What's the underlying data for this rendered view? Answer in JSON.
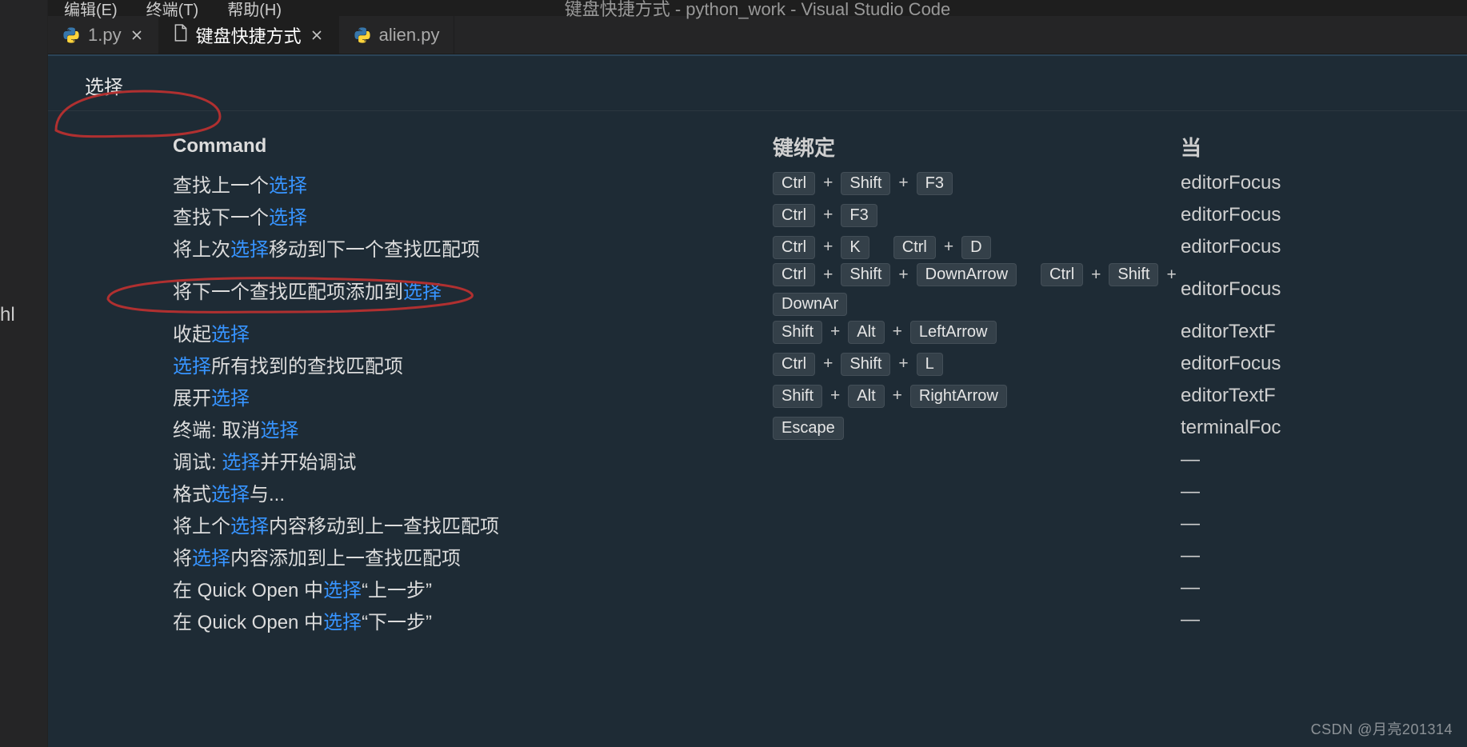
{
  "window": {
    "title": "键盘快捷方式 - python_work - Visual Studio Code"
  },
  "menubar": {
    "items": [
      "编辑(E)",
      "终端(T)",
      "帮助(H)"
    ]
  },
  "sidebar": {
    "truncated_label": "hl"
  },
  "tabs": [
    {
      "icon": "python",
      "label": "1.py",
      "active": false,
      "closeable": true
    },
    {
      "icon": "document",
      "label": "键盘快捷方式",
      "active": true,
      "closeable": true
    },
    {
      "icon": "python",
      "label": "alien.py",
      "active": false,
      "closeable": false
    }
  ],
  "search": {
    "value": "选择"
  },
  "columns": {
    "command": "Command",
    "keybinding": "键绑定",
    "when": "当"
  },
  "rows": [
    {
      "cmd": [
        {
          "t": "查找上一个"
        },
        {
          "t": "选择",
          "hl": true
        }
      ],
      "keys": [
        [
          "Ctrl",
          "Shift",
          "F3"
        ]
      ],
      "when": "editorFocus"
    },
    {
      "cmd": [
        {
          "t": "查找下一个"
        },
        {
          "t": "选择",
          "hl": true
        }
      ],
      "keys": [
        [
          "Ctrl",
          "F3"
        ]
      ],
      "when": "editorFocus"
    },
    {
      "cmd": [
        {
          "t": "将上次"
        },
        {
          "t": "选择",
          "hl": true
        },
        {
          "t": "移动到下一个查找匹配项"
        }
      ],
      "keys": [
        [
          "Ctrl",
          "K"
        ],
        [
          "Ctrl",
          "D"
        ]
      ],
      "when": "editorFocus"
    },
    {
      "cmd": [
        {
          "t": "将下一个查找匹配项添加到"
        },
        {
          "t": "选择",
          "hl": true
        }
      ],
      "keys": [
        [
          "Ctrl",
          "Shift",
          "DownArrow"
        ],
        [
          "Ctrl",
          "Shift",
          "DownAr"
        ]
      ],
      "when": "editorFocus"
    },
    {
      "cmd": [
        {
          "t": "收起"
        },
        {
          "t": "选择",
          "hl": true
        }
      ],
      "keys": [
        [
          "Shift",
          "Alt",
          "LeftArrow"
        ]
      ],
      "when": "editorTextF"
    },
    {
      "cmd": [
        {
          "t": "选择",
          "hl": true
        },
        {
          "t": "所有找到的查找匹配项"
        }
      ],
      "keys": [
        [
          "Ctrl",
          "Shift",
          "L"
        ]
      ],
      "when": "editorFocus"
    },
    {
      "cmd": [
        {
          "t": "展开"
        },
        {
          "t": "选择",
          "hl": true
        }
      ],
      "keys": [
        [
          "Shift",
          "Alt",
          "RightArrow"
        ]
      ],
      "when": "editorTextF"
    },
    {
      "cmd": [
        {
          "t": "终端: 取消"
        },
        {
          "t": "选择",
          "hl": true
        }
      ],
      "keys": [
        [
          "Escape"
        ]
      ],
      "when": "terminalFoc"
    },
    {
      "cmd": [
        {
          "t": "调试: "
        },
        {
          "t": "选择",
          "hl": true
        },
        {
          "t": "并开始调试"
        }
      ],
      "keys": [],
      "when": "—"
    },
    {
      "cmd": [
        {
          "t": "格式"
        },
        {
          "t": "选择",
          "hl": true
        },
        {
          "t": "与..."
        }
      ],
      "keys": [],
      "when": "—"
    },
    {
      "cmd": [
        {
          "t": "将上个"
        },
        {
          "t": "选择",
          "hl": true
        },
        {
          "t": "内容移动到上一查找匹配项"
        }
      ],
      "keys": [],
      "when": "—"
    },
    {
      "cmd": [
        {
          "t": "将"
        },
        {
          "t": "选择",
          "hl": true
        },
        {
          "t": "内容添加到上一查找匹配项"
        }
      ],
      "keys": [],
      "when": "—"
    },
    {
      "cmd": [
        {
          "t": "在 Quick Open 中"
        },
        {
          "t": "选择",
          "hl": true
        },
        {
          "t": "“上一步”"
        }
      ],
      "keys": [],
      "when": "—"
    },
    {
      "cmd": [
        {
          "t": "在 Quick Open 中"
        },
        {
          "t": "选择",
          "hl": true
        },
        {
          "t": "“下一步”"
        }
      ],
      "keys": [],
      "when": "—"
    }
  ],
  "watermark": "CSDN @月亮201314"
}
